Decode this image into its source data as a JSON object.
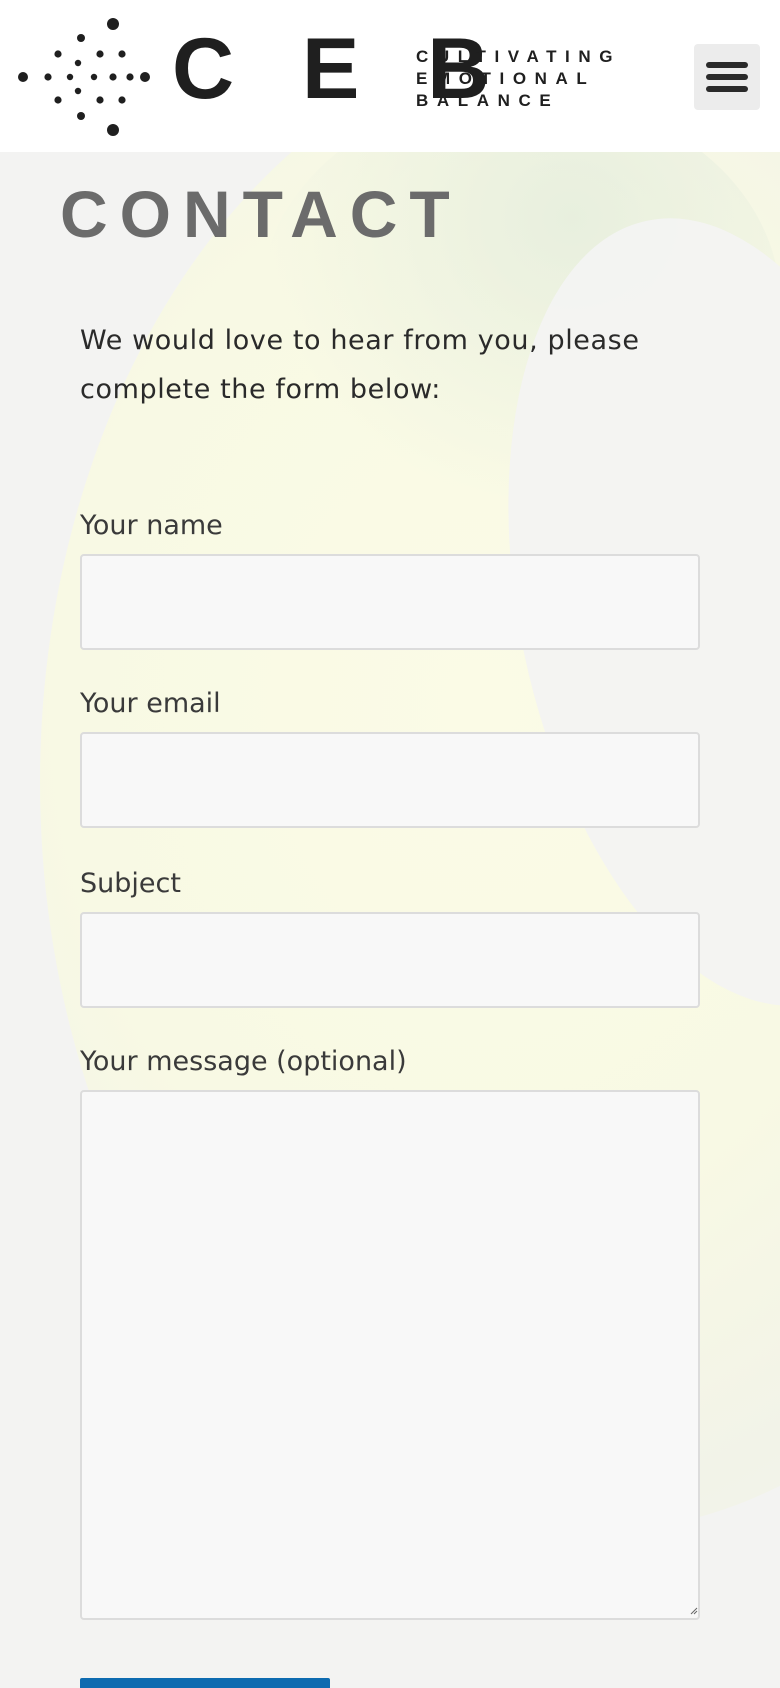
{
  "header": {
    "logo": {
      "letters": "C E B",
      "tagline": [
        "CULTIVATING",
        "EMOTIONAL",
        "BALANCE"
      ]
    },
    "menu_icon": "hamburger-menu-icon"
  },
  "main": {
    "title": "CONTACT",
    "intro": "We would love to hear from you, please complete the form below:",
    "form": {
      "name_label": "Your name",
      "name_value": "",
      "email_label": "Your email",
      "email_value": "",
      "subject_label": "Subject",
      "subject_value": "",
      "message_label": "Your message (optional)",
      "message_value": ""
    }
  },
  "colors": {
    "header_bg": "#ffffff",
    "title": "#6b6b6b",
    "submit_button": "#0d6bb0",
    "input_bg": "#f8f8f8",
    "input_border": "#dcdcdc"
  }
}
